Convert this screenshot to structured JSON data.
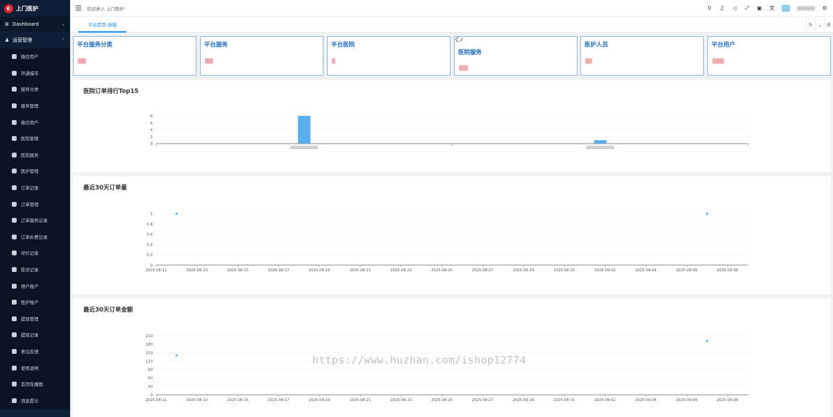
{
  "app": {
    "title": "上门医护",
    "breadcrumb": "欢迎进入 上门医护"
  },
  "sidebar": {
    "dashboard": "Dashboard",
    "group": "运营管理",
    "items": [
      {
        "label": "微信用户",
        "icon": "wechat-icon"
      },
      {
        "label": "开通城市",
        "icon": "city-icon"
      },
      {
        "label": "服务分类",
        "icon": "category-icon"
      },
      {
        "label": "服务管理",
        "icon": "cart-icon"
      },
      {
        "label": "微信用户",
        "icon": "wechat-icon"
      },
      {
        "label": "医院管理",
        "icon": "user-icon"
      },
      {
        "label": "医院服务",
        "icon": "service-icon"
      },
      {
        "label": "医护管理",
        "icon": "nurse-icon"
      },
      {
        "label": "订单记录",
        "icon": "order-icon"
      },
      {
        "label": "订单管理",
        "icon": "order-manage-icon"
      },
      {
        "label": "订单服务记录",
        "icon": "camera-icon"
      },
      {
        "label": "订单补费记录",
        "icon": "fee-icon"
      },
      {
        "label": "评价记录",
        "icon": "review-icon"
      },
      {
        "label": "投诉记录",
        "icon": "complaint-icon"
      },
      {
        "label": "用户账户",
        "icon": "account-icon"
      },
      {
        "label": "医护账户",
        "icon": "nurse-account-icon"
      },
      {
        "label": "提现管理",
        "icon": "withdraw-icon"
      },
      {
        "label": "提现记录",
        "icon": "withdraw-record-icon"
      },
      {
        "label": "意见反馈",
        "icon": "feedback-icon"
      },
      {
        "label": "使用说明",
        "icon": "manual-icon"
      },
      {
        "label": "首页轮播图",
        "icon": "image-icon"
      },
      {
        "label": "消息提示",
        "icon": "message-icon"
      }
    ]
  },
  "tabs": [
    {
      "label": "平台首页-新版"
    }
  ],
  "cards": [
    {
      "title": "平台服务分类"
    },
    {
      "title": "平台服务"
    },
    {
      "title": "平台医院"
    },
    {
      "title": "医院服务",
      "badge": "C✓"
    },
    {
      "title": "医护人员"
    },
    {
      "title": "平台用户"
    }
  ],
  "colors": {
    "sidebar_bg": "#0e1f36",
    "accent": "#1890ff",
    "card_title": "#1e6fc4",
    "bar": "#5aaef0",
    "point": "#6cb6ee"
  },
  "watermark": "https://www.huzhan.com/ishop12774",
  "chart_data": [
    {
      "type": "bar",
      "title": "医院订单排行Top15",
      "categories": [
        "",
        ""
      ],
      "values": [
        8,
        1
      ],
      "ylim": [
        0,
        8
      ],
      "yticks": [
        0,
        2,
        4,
        6,
        8
      ],
      "grid": true
    },
    {
      "type": "scatter",
      "title": "最近30天订单量",
      "x": [
        "2025-08-12",
        "2025-09-07"
      ],
      "values": [
        1,
        1
      ],
      "xticks": [
        "2025-08-11",
        "2025-08-13",
        "2025-08-15",
        "2025-08-17",
        "2025-08-19",
        "2025-08-21",
        "2025-08-23",
        "2025-08-25",
        "2025-08-27",
        "2025-08-29",
        "2025-08-31",
        "2025-09-02",
        "2025-09-04",
        "2025-09-06",
        "2025-09-08"
      ],
      "yticks": [
        0,
        0.2,
        0.4,
        0.6,
        0.8,
        1
      ],
      "ylim": [
        0,
        1
      ],
      "grid": true
    },
    {
      "type": "scatter",
      "title": "最近30天订单金额",
      "x": [
        "2025-08-12",
        "2025-09-07"
      ],
      "values": [
        140,
        192
      ],
      "xticks": [
        "2025-08-11",
        "2025-08-13",
        "2025-08-15",
        "2025-08-17",
        "2025-08-19",
        "2025-08-21",
        "2025-08-23",
        "2025-08-25",
        "2025-08-27",
        "2025-08-29",
        "2025-08-31",
        "2025-09-02",
        "2025-09-04",
        "2025-09-06",
        "2025-09-08"
      ],
      "yticks": [
        0,
        30,
        60,
        90,
        120,
        150,
        180,
        210
      ],
      "ylim": [
        0,
        210
      ],
      "grid": true
    }
  ]
}
